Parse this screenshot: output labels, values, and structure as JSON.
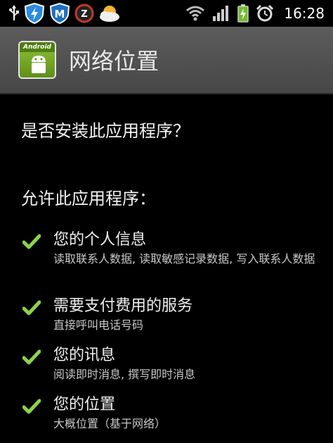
{
  "status_bar": {
    "time": "16:28",
    "left_icons": [
      "usb-icon",
      "shield-notification-icon",
      "m-app-icon",
      "z-app-icon",
      "weather-icon"
    ],
    "right_icons": [
      "wifi-icon",
      "signal-icon",
      "battery-charging-icon",
      "alarm-clock-icon"
    ]
  },
  "header": {
    "app_icon_label": "Android",
    "title": "网络位置"
  },
  "question": "是否安装此应用程序？",
  "allow_heading": "允许此应用程序：",
  "permissions": [
    {
      "title": "您的个人信息",
      "desc": "读取联系人数据, 读取敏感记录数据, 写入联系人数据"
    },
    {
      "title": "需要支付费用的服务",
      "desc": "直接呼叫电话号码"
    },
    {
      "title": "您的讯息",
      "desc": "阅读即时消息, 撰写即时消息"
    },
    {
      "title": "您的位置",
      "desc": "大概位置（基于网络）"
    }
  ],
  "colors": {
    "check": "#8bd34a",
    "title_bar": "#505050"
  }
}
